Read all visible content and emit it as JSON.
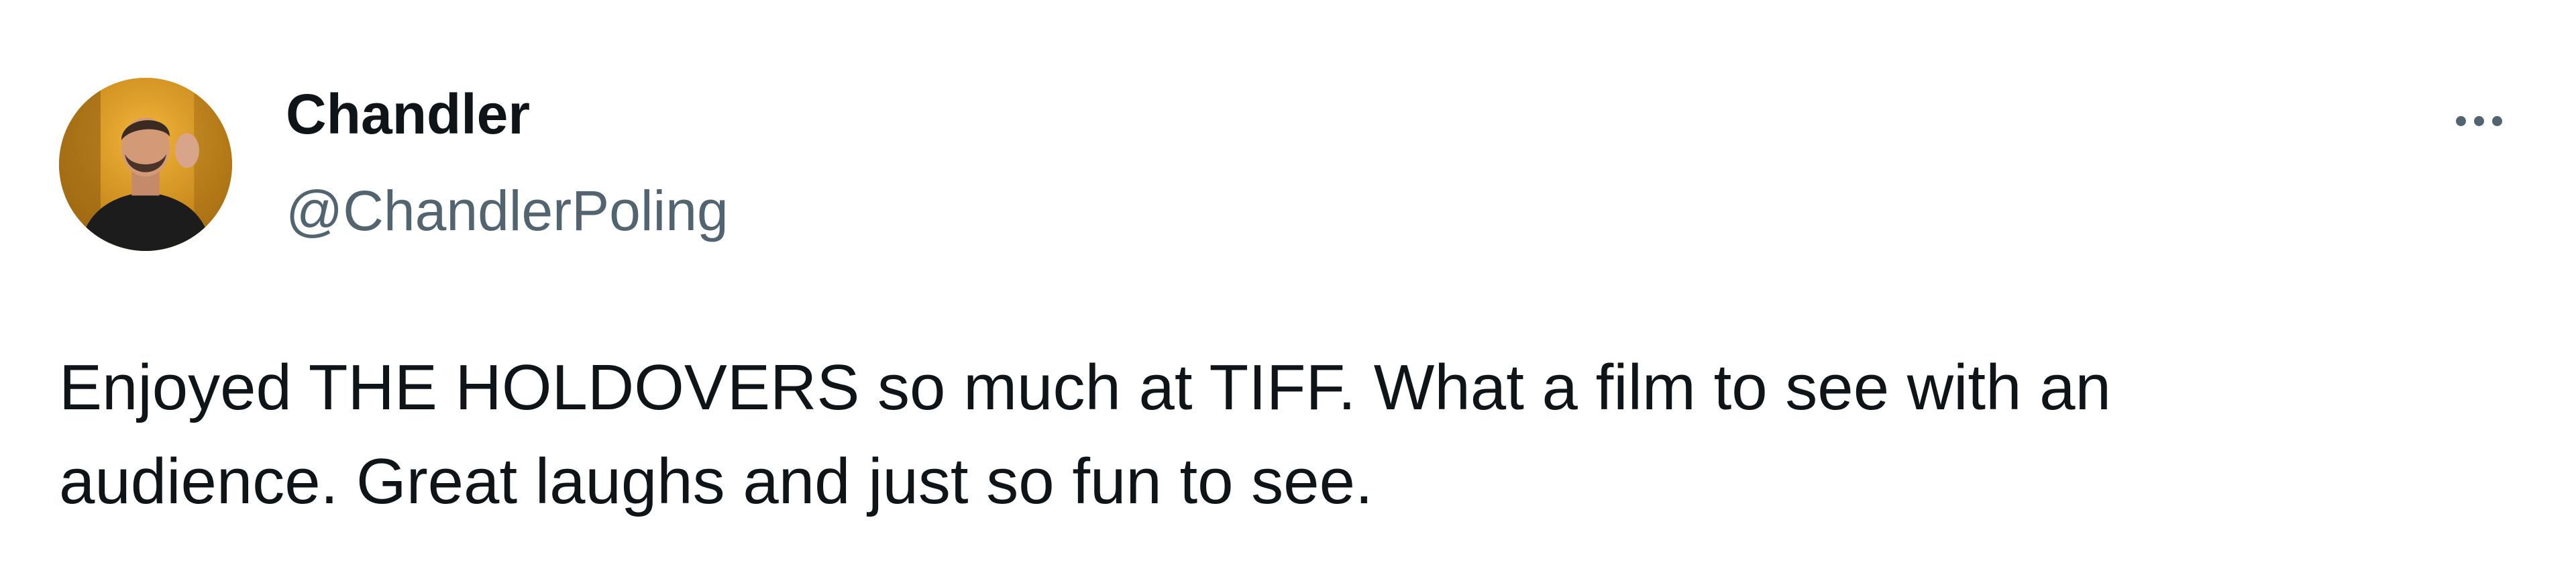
{
  "tweet": {
    "author": {
      "display_name": "Chandler",
      "handle": "@ChandlerPoling",
      "avatar_icon": "profile-photo"
    },
    "more_icon": "more-horizontal-icon",
    "text_lines": [
      "Enjoyed THE HOLDOVERS so much at TIFF. What a film to see with an",
      "audience. Great laughs and just so fun to see."
    ]
  },
  "colors": {
    "name": "#0f1419",
    "handle": "#536471",
    "text": "#0f1419",
    "background": "#ffffff"
  }
}
